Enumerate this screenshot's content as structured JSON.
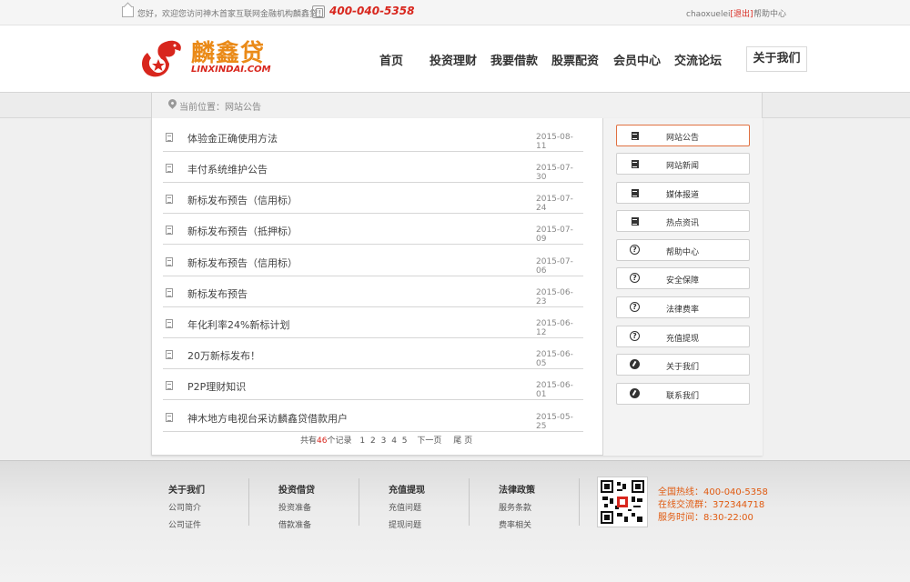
{
  "topbar": {
    "welcome": "您好，欢迎您访问神木首家互联网金融机构麟鑫贷！",
    "phone": "400-040-5358",
    "username": "chaoxuelei",
    "logout": "[退出]",
    "help": "帮助中心"
  },
  "logo": {
    "brand": "麟鑫贷",
    "domain": "LINXINDAI.COM"
  },
  "nav": {
    "items": [
      "首页",
      "投资理财",
      "我要借款",
      "股票配资",
      "会员中心",
      "交流论坛"
    ],
    "about": "关于我们"
  },
  "breadcrumb": {
    "text": "当前位置：网站公告"
  },
  "news": [
    {
      "title": "体验金正确使用方法",
      "date": "2015-08-11"
    },
    {
      "title": "丰付系统维护公告",
      "date": "2015-07-30"
    },
    {
      "title": "新标发布预告（信用标）",
      "date": "2015-07-24"
    },
    {
      "title": "新标发布预告（抵押标）",
      "date": "2015-07-09"
    },
    {
      "title": "新标发布预告（信用标）",
      "date": "2015-07-06"
    },
    {
      "title": "新标发布预告",
      "date": "2015-06-23"
    },
    {
      "title": "年化利率24%新标计划",
      "date": "2015-06-12"
    },
    {
      "title": "20万新标发布！",
      "date": "2015-06-05"
    },
    {
      "title": "P2P理财知识",
      "date": "2015-06-01"
    },
    {
      "title": "神木地方电视台采访麟鑫贷借款用户",
      "date": "2015-05-25"
    }
  ],
  "pager": {
    "prefix": "共有",
    "count": "46",
    "suffix": "个记录",
    "pages": [
      "1",
      "2",
      "3",
      "4",
      "5"
    ],
    "next": "下一页",
    "last": "尾 页"
  },
  "sidebar": [
    {
      "label": "网站公告",
      "icon": "document-icon"
    },
    {
      "label": "网站新闻",
      "icon": "document-icon"
    },
    {
      "label": "媒体报道",
      "icon": "document-icon"
    },
    {
      "label": "热点资讯",
      "icon": "document-icon"
    },
    {
      "label": "帮助中心",
      "icon": "question-icon"
    },
    {
      "label": "安全保障",
      "icon": "question-icon"
    },
    {
      "label": "法律费率",
      "icon": "question-icon"
    },
    {
      "label": "充值提现",
      "icon": "question-icon"
    },
    {
      "label": "关于我们",
      "icon": "compass-icon"
    },
    {
      "label": "联系我们",
      "icon": "compass-icon"
    }
  ],
  "footer": {
    "columns": [
      {
        "heading": "关于我们",
        "links": [
          "公司简介",
          "公司证件"
        ]
      },
      {
        "heading": "投资借贷",
        "links": [
          "投资准备",
          "借款准备"
        ]
      },
      {
        "heading": "充值提现",
        "links": [
          "充值问题",
          "提现问题"
        ]
      },
      {
        "heading": "法律政策",
        "links": [
          "服务条款",
          "费率相关"
        ]
      }
    ],
    "contact": {
      "hotline": "全国热线：400-040-5358",
      "qq_group": "在线交流群：372344718",
      "hours": "服务时间：8:30-22:00"
    }
  },
  "colors": {
    "accent": "#d8261d",
    "brand_orange": "#ea8a18",
    "footer_orange": "#e05a10"
  }
}
